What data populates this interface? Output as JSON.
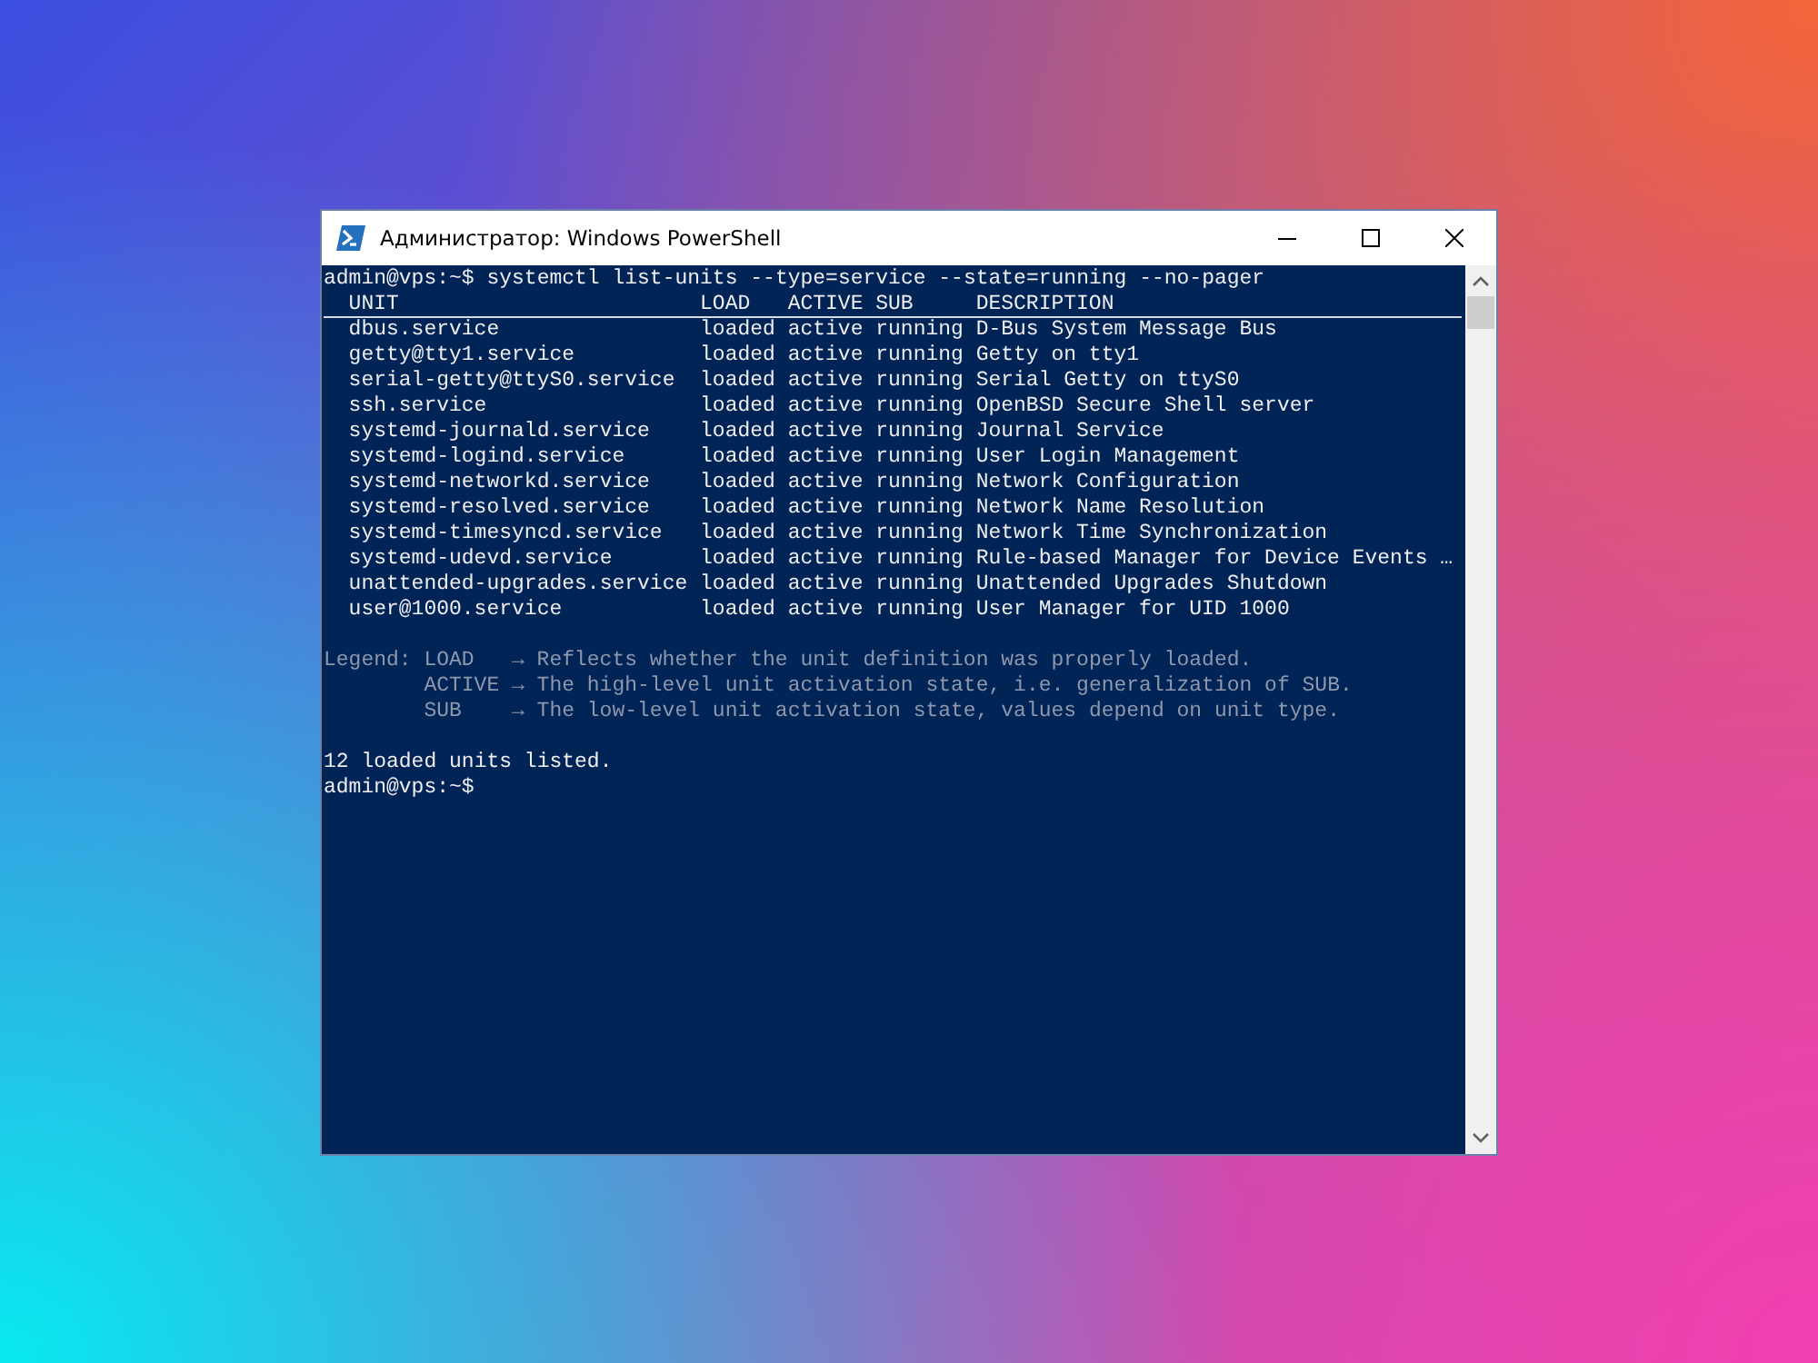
{
  "window": {
    "title": "Администратор: Windows PowerShell"
  },
  "terminal": {
    "command_line": "admin@vps:~$ systemctl list-units --type=service --state=running --no-pager",
    "columns": [
      "UNIT",
      "LOAD",
      "ACTIVE",
      "SUB",
      "DESCRIPTION"
    ],
    "rows": [
      {
        "unit": "dbus.service",
        "load": "loaded",
        "active": "active",
        "sub": "running",
        "description": "D-Bus System Message Bus"
      },
      {
        "unit": "getty@tty1.service",
        "load": "loaded",
        "active": "active",
        "sub": "running",
        "description": "Getty on tty1"
      },
      {
        "unit": "serial-getty@ttyS0.service",
        "load": "loaded",
        "active": "active",
        "sub": "running",
        "description": "Serial Getty on ttyS0"
      },
      {
        "unit": "ssh.service",
        "load": "loaded",
        "active": "active",
        "sub": "running",
        "description": "OpenBSD Secure Shell server"
      },
      {
        "unit": "systemd-journald.service",
        "load": "loaded",
        "active": "active",
        "sub": "running",
        "description": "Journal Service"
      },
      {
        "unit": "systemd-logind.service",
        "load": "loaded",
        "active": "active",
        "sub": "running",
        "description": "User Login Management"
      },
      {
        "unit": "systemd-networkd.service",
        "load": "loaded",
        "active": "active",
        "sub": "running",
        "description": "Network Configuration"
      },
      {
        "unit": "systemd-resolved.service",
        "load": "loaded",
        "active": "active",
        "sub": "running",
        "description": "Network Name Resolution"
      },
      {
        "unit": "systemd-timesyncd.service",
        "load": "loaded",
        "active": "active",
        "sub": "running",
        "description": "Network Time Synchronization"
      },
      {
        "unit": "systemd-udevd.service",
        "load": "loaded",
        "active": "active",
        "sub": "running",
        "description": "Rule-based Manager for Device Events …"
      },
      {
        "unit": "unattended-upgrades.service",
        "load": "loaded",
        "active": "active",
        "sub": "running",
        "description": "Unattended Upgrades Shutdown"
      },
      {
        "unit": "user@1000.service",
        "load": "loaded",
        "active": "active",
        "sub": "running",
        "description": "User Manager for UID 1000"
      }
    ],
    "legend": {
      "label": "Legend:",
      "items": [
        {
          "key": "LOAD",
          "arrow": "→",
          "text": "Reflects whether the unit definition was properly loaded."
        },
        {
          "key": "ACTIVE",
          "arrow": "→",
          "text": "The high-level unit activation state, i.e. generalization of SUB."
        },
        {
          "key": "SUB",
          "arrow": "→",
          "text": "The low-level unit activation state, values depend on unit type."
        }
      ]
    },
    "summary": "12 loaded units listed.",
    "prompt": "admin@vps:~$"
  }
}
